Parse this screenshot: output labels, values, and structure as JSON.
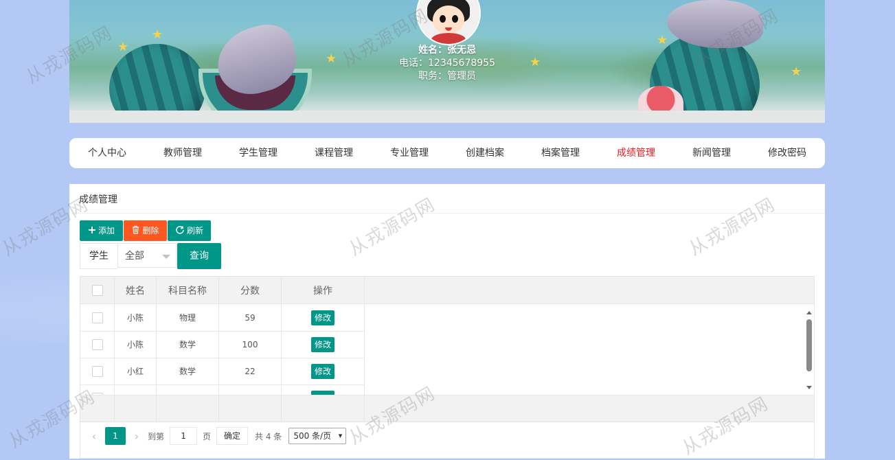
{
  "user": {
    "name_line": "姓名：张无忌",
    "phone_line": "电话：12345678955",
    "role_line": "职务：管理员"
  },
  "nav": {
    "items": [
      {
        "label": "个人中心"
      },
      {
        "label": "教师管理"
      },
      {
        "label": "学生管理"
      },
      {
        "label": "课程管理"
      },
      {
        "label": "专业管理"
      },
      {
        "label": "创建档案"
      },
      {
        "label": "档案管理"
      },
      {
        "label": "成绩管理"
      },
      {
        "label": "新闻管理"
      },
      {
        "label": "修改密码"
      }
    ],
    "active_index": 7,
    "active_color": "#e41e1e"
  },
  "panel": {
    "title": "成绩管理"
  },
  "toolbar": {
    "add_label": "添加",
    "add_icon": "plus-icon",
    "delete_label": "删除",
    "delete_icon": "trash-icon",
    "refresh_label": "刷新",
    "refresh_icon": "refresh-icon"
  },
  "search": {
    "label": "学生",
    "select_value": "全部",
    "button_label": "查询"
  },
  "table": {
    "headers": [
      "姓名",
      "科目名称",
      "分数",
      "操作"
    ],
    "rows": [
      {
        "name": "小陈",
        "subject": "物理",
        "score": "59",
        "action": "修改"
      },
      {
        "name": "小陈",
        "subject": "数学",
        "score": "100",
        "action": "修改"
      },
      {
        "name": "小红",
        "subject": "数学",
        "score": "22",
        "action": "修改"
      }
    ]
  },
  "pager": {
    "current_page": "1",
    "goto_label": "到第",
    "goto_value": "1",
    "page_unit": "页",
    "confirm_label": "确定",
    "total_text": "共 4 条",
    "page_size": "500 条/页"
  },
  "watermark": "从戎源码网",
  "colors": {
    "primary": "#009688",
    "danger": "#ff5722",
    "background": "#b3c8f5"
  }
}
